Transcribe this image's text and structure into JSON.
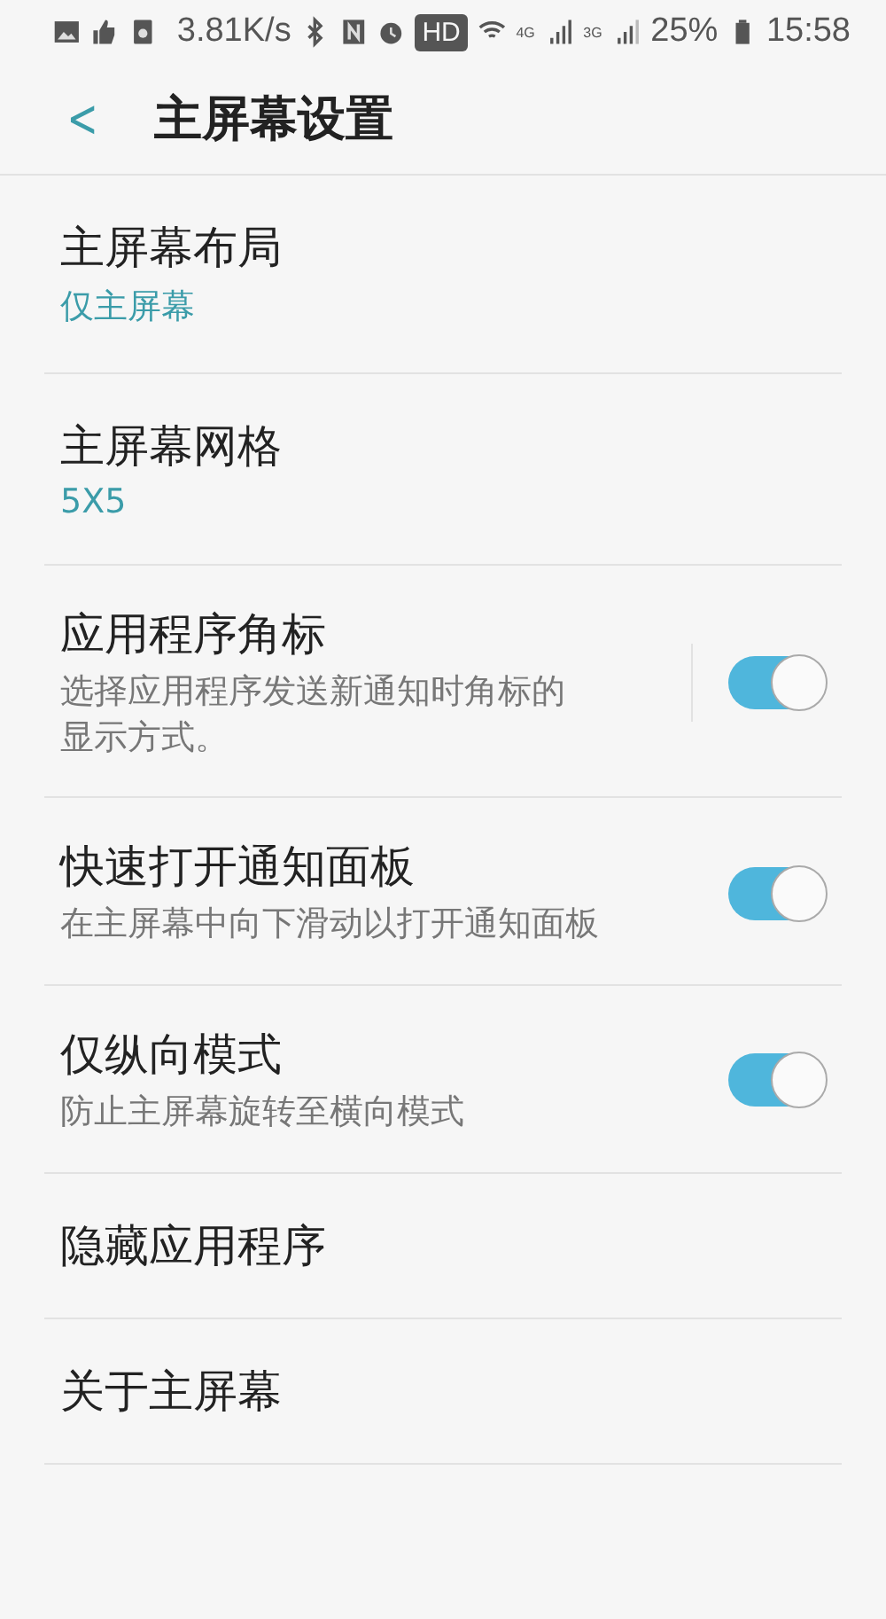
{
  "status_bar": {
    "speed": "3.81K/s",
    "hd": "HD",
    "network_1": "4G",
    "network_2": "3G",
    "battery": "25%",
    "time": "15:58"
  },
  "header": {
    "back": "<",
    "title": "主屏幕设置"
  },
  "items": [
    {
      "kind": "value",
      "title": "主屏幕布局",
      "value": "仅主屏幕"
    },
    {
      "kind": "value",
      "title": "主屏幕网格",
      "value": "5X5"
    },
    {
      "kind": "toggle",
      "title": "应用程序角标",
      "description": "选择应用程序发送新通知时角标的显示方式。",
      "on": true,
      "separated": true
    },
    {
      "kind": "toggle",
      "title": "快速打开通知面板",
      "description": "在主屏幕中向下滑动以打开通知面板",
      "on": true,
      "separated": false
    },
    {
      "kind": "toggle",
      "title": "仅纵向模式",
      "description": "防止主屏幕旋转至横向模式",
      "on": true,
      "separated": false
    },
    {
      "kind": "plain",
      "title": "隐藏应用程序"
    },
    {
      "kind": "plain",
      "title": "关于主屏幕"
    }
  ]
}
